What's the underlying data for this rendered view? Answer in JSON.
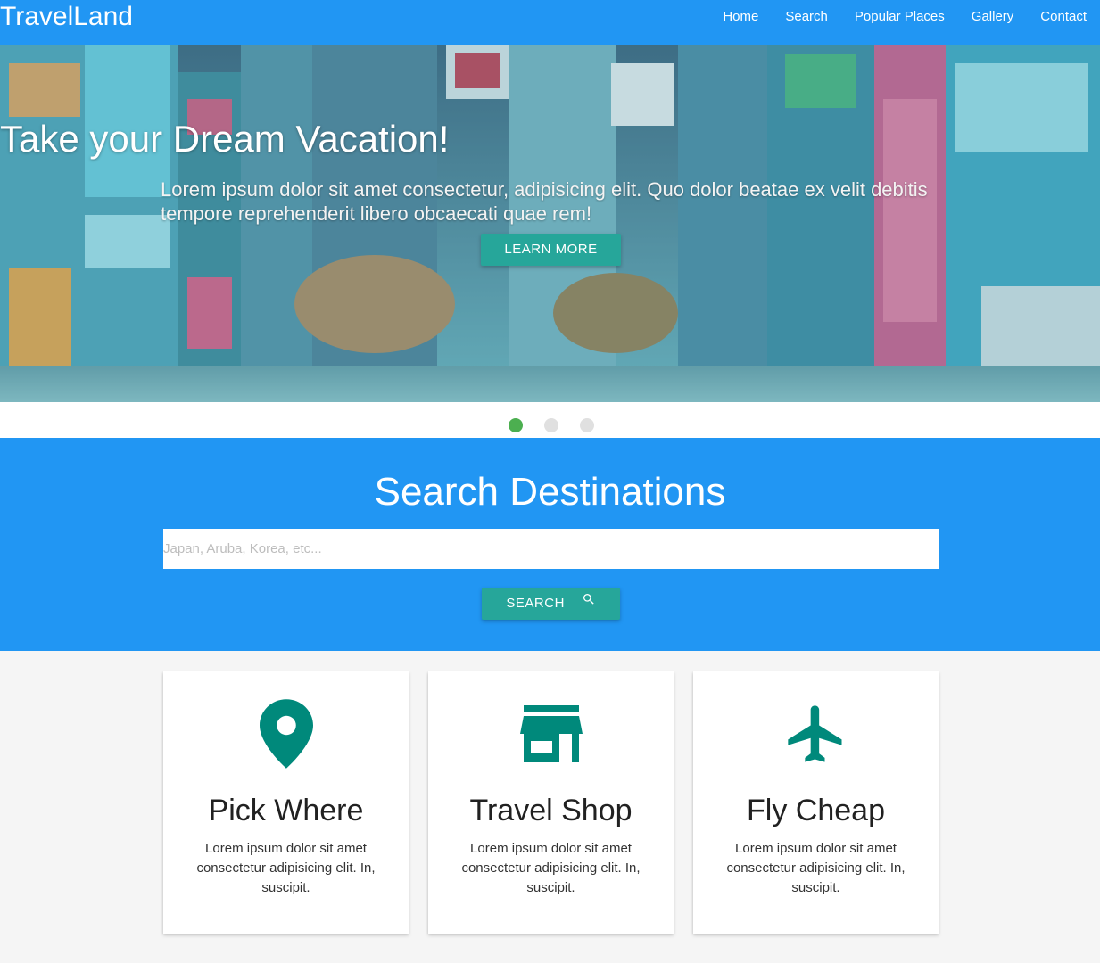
{
  "nav": {
    "brand": "TravelLand",
    "links": [
      "Home",
      "Search",
      "Popular Places",
      "Gallery",
      "Contact"
    ]
  },
  "hero": {
    "title": "Take your Dream Vacation!",
    "text": "Lorem ipsum dolor sit amet consectetur, adipisicing elit. Quo dolor beatae ex velit debitis tempore reprehenderit libero obcaecati quae rem!",
    "button": "LEARN MORE",
    "slides": 3,
    "active_slide": 1
  },
  "search": {
    "title": "Search Destinations",
    "placeholder": "Japan, Aruba, Korea, etc...",
    "value": "",
    "button": "SEARCH",
    "button_icon": "search-icon"
  },
  "cards": [
    {
      "icon": "map-pin-icon",
      "title": "Pick Where",
      "text": "Lorem ipsum dolor sit amet consectetur adipisicing elit. In, suscipit."
    },
    {
      "icon": "store-icon",
      "title": "Travel Shop",
      "text": "Lorem ipsum dolor sit amet consectetur adipisicing elit. In, suscipit."
    },
    {
      "icon": "airplane-icon",
      "title": "Fly Cheap",
      "text": "Lorem ipsum dolor sit amet consectetur adipisicing elit. In, suscipit."
    }
  ],
  "colors": {
    "primary": "#2196f3",
    "accent": "#26a69a",
    "icon": "#00897b",
    "active_dot": "#4caf50"
  }
}
